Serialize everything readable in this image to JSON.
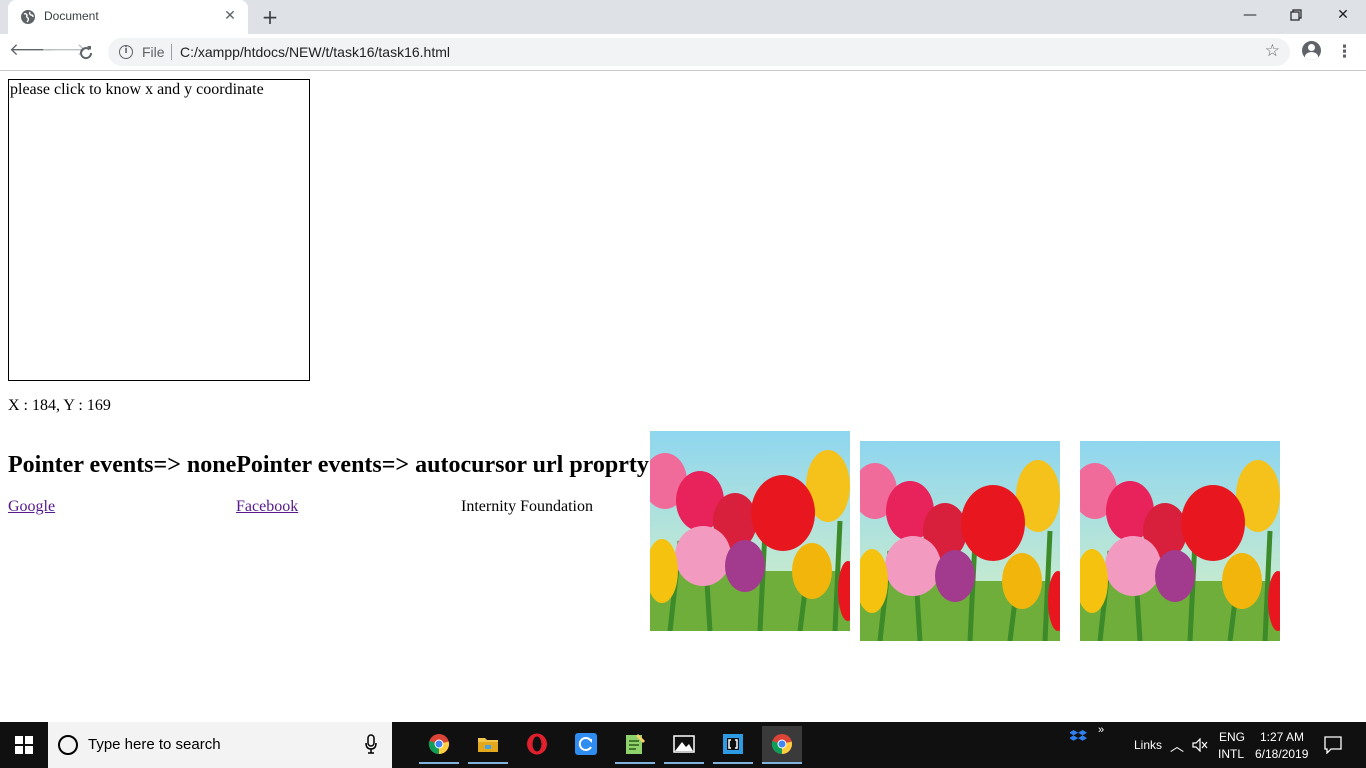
{
  "browser": {
    "tab_title": "Document",
    "address_scheme": "File",
    "address_url": "C:/xampp/htdocs/NEW/t/task16/task16.html"
  },
  "page": {
    "click_box_text": "please click to know x and y coordinate",
    "coordinates_text": "X : 184, Y : 169",
    "heading": "Pointer events=> nonePointer events=> autocursor url proprty",
    "links": {
      "google": "Google",
      "facebook": "Facebook",
      "internity": "Internity Foundation"
    }
  },
  "taskbar": {
    "search_placeholder": "Type here to search",
    "links_label": "Links",
    "language": "ENG",
    "layout": "INTL",
    "time": "1:27 AM",
    "date": "6/18/2019"
  },
  "colors": {
    "visited_link": "#551a8b",
    "tab_strip": "#dee1e6",
    "taskbar": "#101010"
  }
}
